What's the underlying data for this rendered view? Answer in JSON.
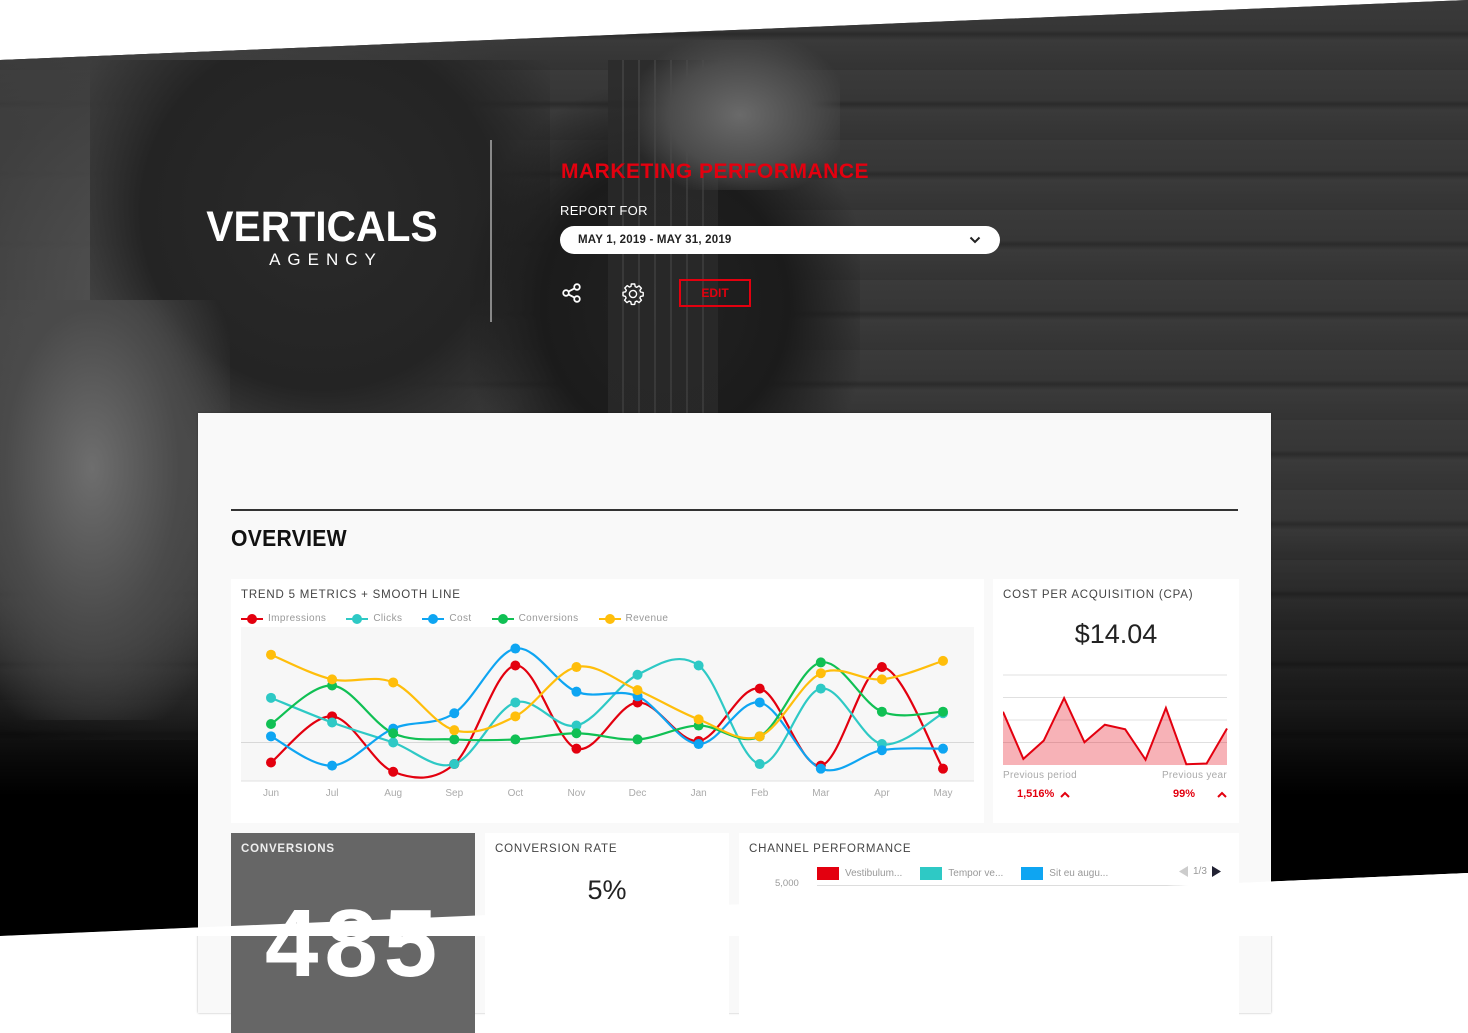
{
  "brand": {
    "name": "VERTICALS",
    "sub": "AGENCY"
  },
  "header": {
    "title": "MARKETING PERFORMANCE",
    "report_for_label": "REPORT FOR",
    "date_range": "MAY 1, 2019 - MAY 31, 2019",
    "actions": {
      "share_icon": "share-icon",
      "settings_icon": "gear-icon",
      "edit_label": "EDIT"
    }
  },
  "colors": {
    "accent": "#e3000f",
    "impressions": "#e3000f",
    "clicks": "#2ec9c5",
    "cost": "#0ea5f2",
    "conversions": "#10c054",
    "revenue": "#ffbe0b"
  },
  "overview": {
    "title": "OVERVIEW"
  },
  "trend": {
    "title": "TREND 5 METRICS + SMOOTH LINE"
  },
  "cpa": {
    "title": "COST PER ACQUISITION (CPA)",
    "value": "$14.04",
    "previous_period_label": "Previous period",
    "previous_period_value": "1,516%",
    "previous_year_label": "Previous year",
    "previous_year_value": "99%"
  },
  "conversions": {
    "title": "CONVERSIONS",
    "value": "485"
  },
  "conversion_rate": {
    "title": "CONVERSION RATE",
    "value": "5%"
  },
  "channel": {
    "title": "CHANNEL PERFORMANCE",
    "legend": [
      {
        "label": "Vestibulum...",
        "color": "#e3000f"
      },
      {
        "label": "Tempor ve...",
        "color": "#2ec9c5"
      },
      {
        "label": "Sit eu augu...",
        "color": "#0ea5f2"
      }
    ],
    "pager": "1/3",
    "ytick": "5,000"
  },
  "chart_data": [
    {
      "type": "line",
      "title": "TREND 5 METRICS + SMOOTH LINE",
      "xlabel": "",
      "ylabel": "",
      "categories": [
        "Jun",
        "Jul",
        "Aug",
        "Sep",
        "Oct",
        "Nov",
        "Dec",
        "Jan",
        "Feb",
        "Mar",
        "Apr",
        "May"
      ],
      "ylim": [
        0,
        100
      ],
      "grid": true,
      "legend": "top-left",
      "series": [
        {
          "name": "Impressions",
          "color": "#e3000f",
          "values": [
            12,
            42,
            6,
            11,
            75,
            21,
            51,
            26,
            60,
            10,
            74,
            8
          ]
        },
        {
          "name": "Clicks",
          "color": "#2ec9c5",
          "values": [
            54,
            38,
            25,
            11,
            51,
            36,
            69,
            75,
            11,
            60,
            24,
            44
          ]
        },
        {
          "name": "Cost",
          "color": "#0ea5f2",
          "values": [
            29,
            10,
            34,
            44,
            86,
            58,
            55,
            24,
            51,
            8,
            20,
            21
          ]
        },
        {
          "name": "Conversions",
          "color": "#10c054",
          "values": [
            37,
            62,
            31,
            27,
            27,
            31,
            27,
            36,
            29,
            77,
            45,
            45
          ]
        },
        {
          "name": "Revenue",
          "color": "#ffbe0b",
          "values": [
            82,
            66,
            64,
            33,
            42,
            74,
            59,
            40,
            29,
            70,
            66,
            78
          ]
        }
      ]
    },
    {
      "type": "area",
      "title": "COST PER ACQUISITION (CPA)",
      "x": [
        1,
        2,
        3,
        4,
        5,
        6,
        7,
        8,
        9,
        10,
        11,
        12
      ],
      "ylim": [
        0,
        100
      ],
      "grid": true,
      "series": [
        {
          "name": "CPA",
          "color": "#e3000f",
          "values": [
            70,
            8,
            32,
            88,
            30,
            53,
            47,
            7,
            75,
            1,
            2,
            48
          ]
        }
      ]
    }
  ]
}
